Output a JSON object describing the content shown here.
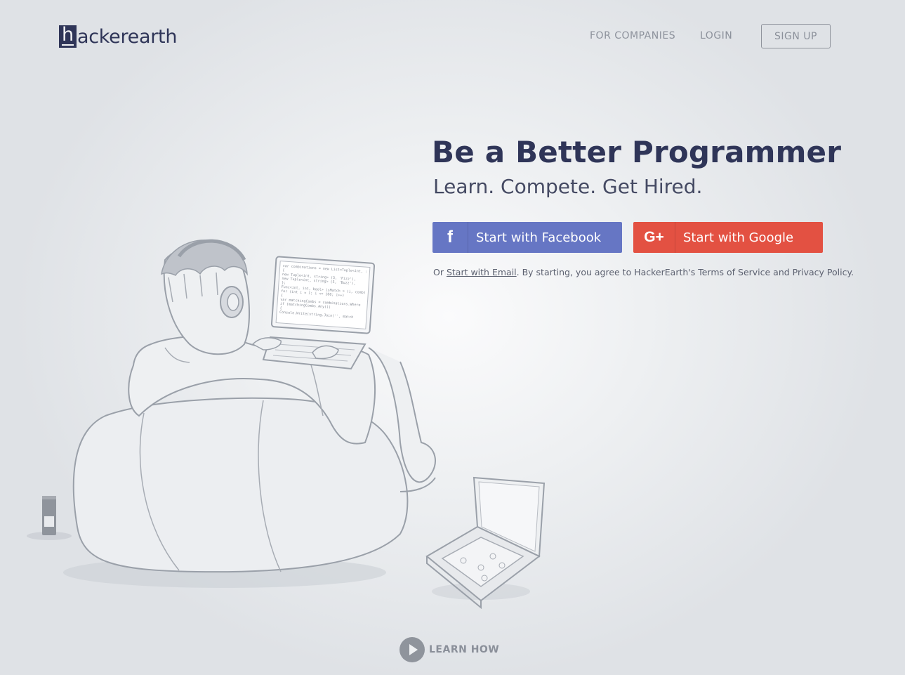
{
  "header": {
    "logo_letter": "h",
    "logo_rest": "ackerearth",
    "nav": {
      "for_companies": "FOR COMPANIES",
      "login": "LOGIN",
      "sign_up": "SIGN UP"
    }
  },
  "hero": {
    "title": "Be a Better Programmer",
    "subtitle": "Learn. Compete. Get Hired.",
    "facebook_button": {
      "icon_glyph": "f",
      "icon": "facebook-icon",
      "label": "Start with Facebook"
    },
    "google_button": {
      "icon_glyph": "G+",
      "icon": "google-plus-icon",
      "label": "Start with Google"
    },
    "terms": {
      "prefix": "Or ",
      "email_link": "Start with Email",
      "suffix": ". By starting, you agree to HackerEarth's Terms of Service and Privacy Policy."
    }
  },
  "learn_how": {
    "icon": "play-icon",
    "label": "LEARN HOW"
  },
  "code_snippet": [
    "var combinations = new List<Tuple<int, :",
    "{",
    "  new Tuple<int, string> (3, 'Fizz'),",
    "  new Tuple<int, string> (5, 'Buzz'),",
    "};",
    "Func<int, int, bool> isMatch = (i, comb)",
    "for (int i = 1; i <= 100; i++)",
    "{",
    "  var matchingCombs = combinations.Where",
    "  if (matchingCombs.Any())",
    "  {",
    "    Console.Write(string.Join('', match"
  ],
  "colors": {
    "brand_navy": "#2f3558",
    "facebook_blue": "#6676c4",
    "google_red": "#e35142",
    "nav_gray": "#8c919b"
  }
}
